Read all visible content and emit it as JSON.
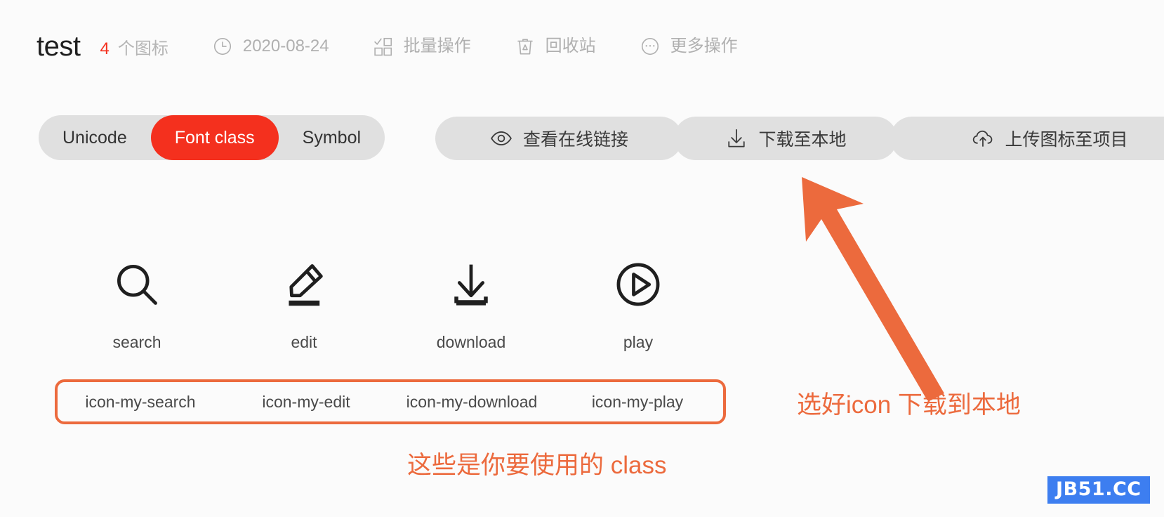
{
  "header": {
    "project_title": "test",
    "icon_count": "4",
    "icon_count_label": "个图标",
    "date": "2020-08-24",
    "date_icon": "clock-icon",
    "batch_label": "批量操作",
    "batch_icon": "batch-select-icon",
    "trash_label": "回收站",
    "trash_icon": "trash-icon",
    "more_label": "更多操作",
    "more_icon": "ellipsis-circle-icon"
  },
  "toolbar": {
    "segments": [
      {
        "label": "Unicode",
        "active": false
      },
      {
        "label": "Font class",
        "active": true
      },
      {
        "label": "Symbol",
        "active": false
      }
    ],
    "buttons": [
      {
        "label": "查看在线链接",
        "icon": "eye-icon"
      },
      {
        "label": "下载至本地",
        "icon": "download-icon"
      },
      {
        "label": "上传图标至项目",
        "icon": "cloud-upload-icon"
      }
    ]
  },
  "icons": [
    {
      "glyph": "search-icon",
      "name": "search",
      "class_name": "icon-my-search"
    },
    {
      "glyph": "edit-pencil-icon",
      "name": "edit",
      "class_name": "icon-my-edit"
    },
    {
      "glyph": "download-tray-icon",
      "name": "download",
      "class_name": "icon-my-download"
    },
    {
      "glyph": "play-circle-icon",
      "name": "play",
      "class_name": "icon-my-play"
    }
  ],
  "annotations": {
    "bottom": "这些是你要使用的 class",
    "right": "选好icon 下载到本地",
    "arrow": "arrow-up-left-icon"
  },
  "watermark": {
    "text": "JB51.CC"
  },
  "colors": {
    "accent_red": "#f4301e",
    "annotation_orange": "#ec6a3d",
    "pill_bg": "#e0e0e0",
    "muted_text": "#b0b0b0",
    "watermark_blue": "#3d7ef0"
  }
}
